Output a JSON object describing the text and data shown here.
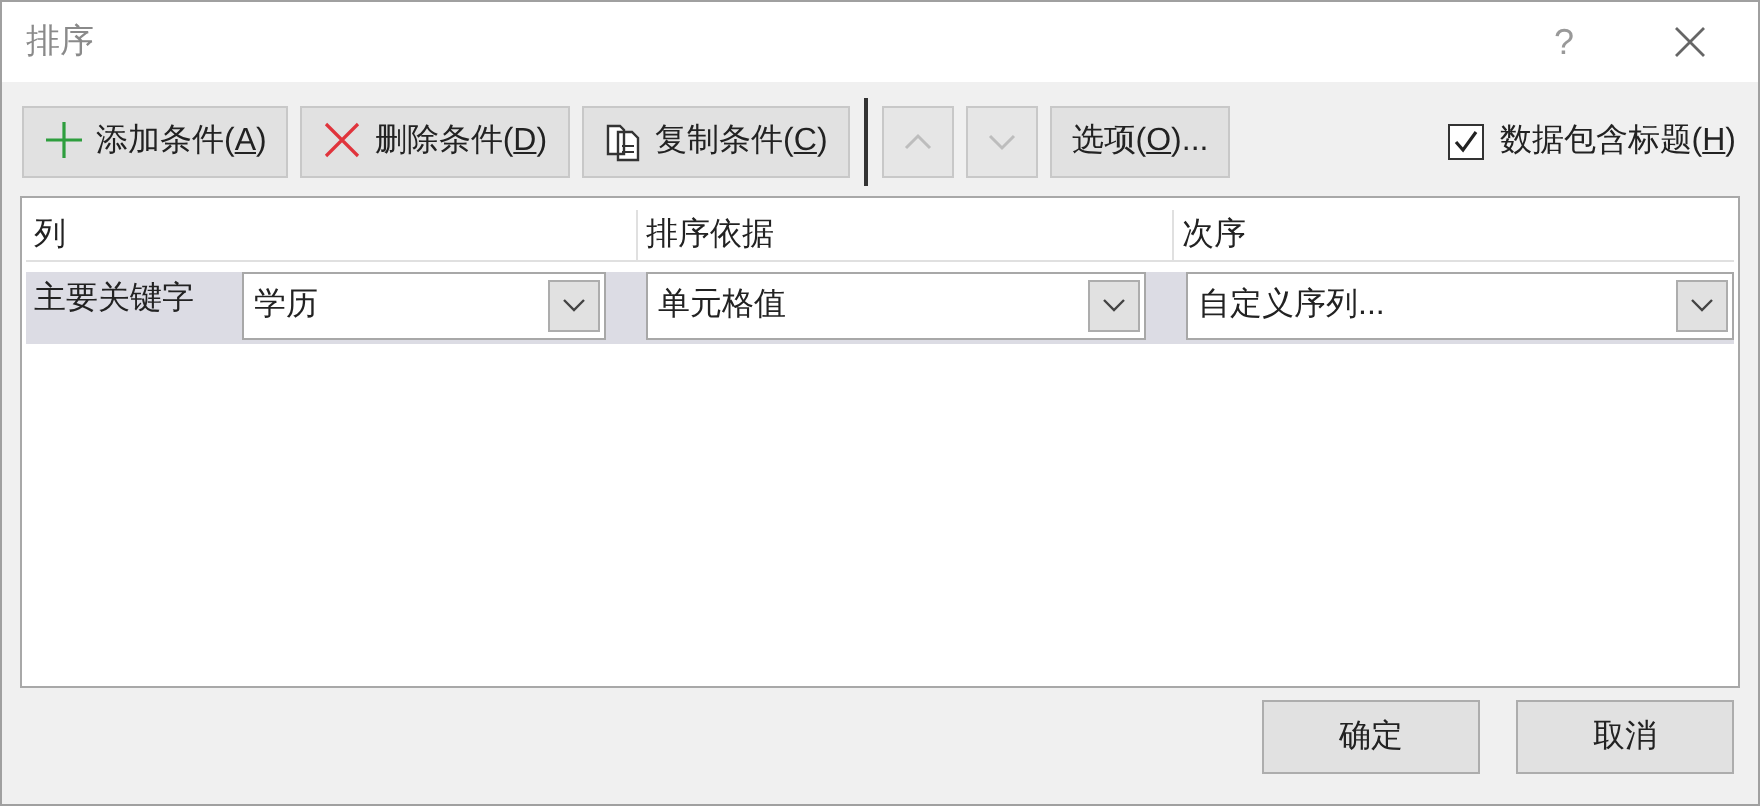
{
  "window": {
    "title": "排序",
    "help": "?"
  },
  "toolbar": [
    {
      "kind": "add",
      "label": "添加条件(",
      "access_key": "A",
      "label_end": ")",
      "disabled": false
    },
    {
      "kind": "delete",
      "label": "删除条件(",
      "access_key": "D",
      "label_end": ")",
      "disabled": false
    },
    {
      "kind": "copy",
      "label": "复制条件(",
      "access_key": "C",
      "label_end": ")",
      "disabled": false
    },
    {
      "kind": "up",
      "disabled": true
    },
    {
      "kind": "down",
      "disabled": true
    },
    {
      "kind": "text",
      "label": "选项(",
      "access_key": "O",
      "label_end": ")...",
      "disabled": false
    }
  ],
  "has_headers": {
    "label": "数据包含标题(",
    "access_key": "H",
    "label_end": ")",
    "checked": true
  },
  "columns": [
    "列",
    "排序依据",
    "次序"
  ],
  "rows": [
    {
      "label": "主要关键字",
      "selected": true,
      "column": "学历",
      "sort_on": "单元格值",
      "order": "自定义序列..."
    }
  ],
  "buttons": [
    {
      "label": "确定"
    },
    {
      "label": "取消"
    }
  ]
}
